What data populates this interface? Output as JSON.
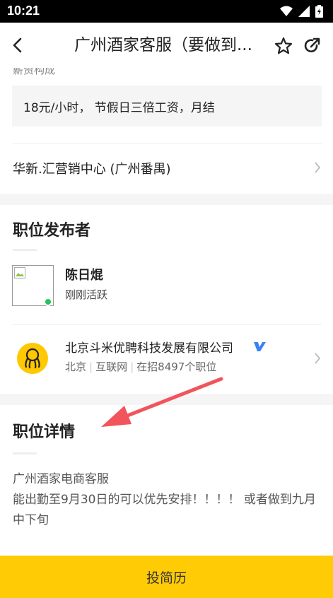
{
  "status_bar": {
    "time": "10:21"
  },
  "nav": {
    "title": "广州酒家客服（要做到..."
  },
  "job": {
    "partial_label": "薪资构成",
    "salary": "18元/小时， 节假日三倍工资，月结",
    "location": "华新.汇营销中心 (广州番禺)"
  },
  "publisher": {
    "section_title": "职位发布者",
    "name": "陈日焜",
    "status": "刚刚活跃",
    "company_name": "北京斗米优聘科技发展有限公司",
    "company_city": "北京",
    "company_industry": "互联网",
    "company_openings": "在招8497个职位"
  },
  "detail": {
    "section_title": "职位详情",
    "line1": "广州酒家电商客服",
    "line2": "能出勤至9月30日的可以优先安排！！！！ 或者做到九月中下旬"
  },
  "apply_button": "投简历",
  "colors": {
    "accent": "#ffcb05",
    "online": "#22c55e",
    "verified": "#3b82f6",
    "annotation_arrow": "#f2545b"
  }
}
